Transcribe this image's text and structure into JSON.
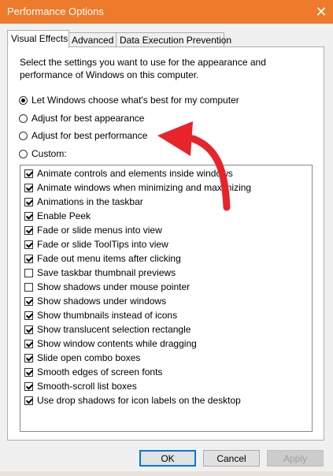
{
  "window": {
    "title": "Performance Options"
  },
  "tabs": [
    {
      "label": "Visual Effects",
      "active": true
    },
    {
      "label": "Advanced",
      "active": false
    },
    {
      "label": "Data Execution Prevention",
      "active": false
    }
  ],
  "intro_text": "Select the settings you want to use for the appearance and performance of Windows on this computer.",
  "radios": [
    {
      "label": "Let Windows choose what's best for my computer",
      "selected": true
    },
    {
      "label": "Adjust for best appearance",
      "selected": false
    },
    {
      "label": "Adjust for best performance",
      "selected": false
    },
    {
      "label": "Custom:",
      "selected": false
    }
  ],
  "effects": [
    {
      "label": "Animate controls and elements inside windows",
      "checked": true
    },
    {
      "label": "Animate windows when minimizing and maximizing",
      "checked": true
    },
    {
      "label": "Animations in the taskbar",
      "checked": true
    },
    {
      "label": "Enable Peek",
      "checked": true
    },
    {
      "label": "Fade or slide menus into view",
      "checked": true
    },
    {
      "label": "Fade or slide ToolTips into view",
      "checked": true
    },
    {
      "label": "Fade out menu items after clicking",
      "checked": true
    },
    {
      "label": "Save taskbar thumbnail previews",
      "checked": false
    },
    {
      "label": "Show shadows under mouse pointer",
      "checked": false
    },
    {
      "label": "Show shadows under windows",
      "checked": true
    },
    {
      "label": "Show thumbnails instead of icons",
      "checked": true
    },
    {
      "label": "Show translucent selection rectangle",
      "checked": true
    },
    {
      "label": "Show window contents while dragging",
      "checked": true
    },
    {
      "label": "Slide open combo boxes",
      "checked": true
    },
    {
      "label": "Smooth edges of screen fonts",
      "checked": true
    },
    {
      "label": "Smooth-scroll list boxes",
      "checked": true
    },
    {
      "label": "Use drop shadows for icon labels on the desktop",
      "checked": true
    }
  ],
  "buttons": {
    "ok": "OK",
    "cancel": "Cancel",
    "apply": "Apply"
  },
  "colors": {
    "titlebar": "#ee7a2c",
    "annotation_arrow": "#e8232a",
    "focus_border": "#0078d7"
  },
  "icons": {
    "close": "close-icon",
    "annotation": "red-curved-arrow-icon"
  }
}
